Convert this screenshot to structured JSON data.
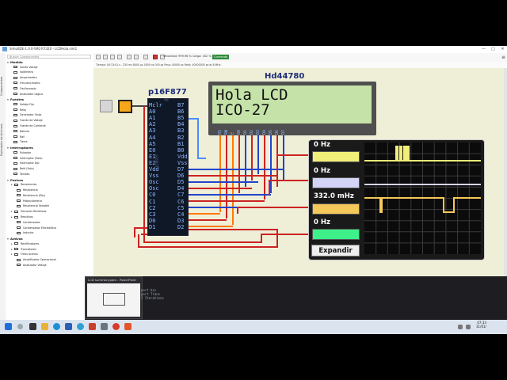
{
  "window": {
    "title": "SimulIDE-1.0.0-SR0 R7320 - LCDHola.sim1",
    "minimize": "—",
    "maximize": "□",
    "close": "✕"
  },
  "vertical_tabs": [
    "Componentes",
    "Explorador de Archivos"
  ],
  "panel": {
    "search_placeholder": "Buscar Componentes",
    "tree": [
      {
        "type": "cat",
        "label": "Medida",
        "open": true
      },
      {
        "type": "item",
        "label": "Sonda Voltaje"
      },
      {
        "type": "item",
        "label": "Voltímetro"
      },
      {
        "type": "item",
        "label": "Amperímetro"
      },
      {
        "type": "item",
        "label": "Frecuencímetro"
      },
      {
        "type": "item",
        "label": "Osciloscopio"
      },
      {
        "type": "item",
        "label": "Analizador Lógico"
      },
      {
        "type": "cat",
        "label": "Fuentes",
        "open": true
      },
      {
        "type": "item",
        "label": "Voltaje Fijo"
      },
      {
        "type": "item",
        "label": "Reloj"
      },
      {
        "type": "item",
        "label": "Generador Onda"
      },
      {
        "type": "item",
        "label": "Fuente de Voltaje"
      },
      {
        "type": "item",
        "label": "Fuente de Corriente"
      },
      {
        "type": "item",
        "label": "Batería"
      },
      {
        "type": "item",
        "label": "Raíl"
      },
      {
        "type": "item",
        "label": "Tierra"
      },
      {
        "type": "cat",
        "label": "Interruptores",
        "open": true
      },
      {
        "type": "item",
        "label": "Pulsador"
      },
      {
        "type": "item",
        "label": "Interruptor (Sola)"
      },
      {
        "type": "item",
        "label": "Interruptor Dip"
      },
      {
        "type": "item",
        "label": "Relé (Sola)"
      },
      {
        "type": "item",
        "label": "Teclado"
      },
      {
        "type": "cat",
        "label": "Pasivos",
        "open": true
      },
      {
        "type": "sub",
        "label": "Resistencias"
      },
      {
        "type": "item2",
        "label": "Resistencia"
      },
      {
        "type": "item2",
        "label": "Resistencia (Dip)"
      },
      {
        "type": "item2",
        "label": "Potenciómetro"
      },
      {
        "type": "item2",
        "label": "Resistencia Variable"
      },
      {
        "type": "sub",
        "label": "Sensores Resistivos"
      },
      {
        "type": "sub",
        "label": "Reactivos"
      },
      {
        "type": "item2",
        "label": "Condensador"
      },
      {
        "type": "item2",
        "label": "Condensador Electrolítico"
      },
      {
        "type": "item2",
        "label": "Inductor"
      },
      {
        "type": "cat",
        "label": "Activos",
        "open": true
      },
      {
        "type": "sub",
        "label": "Rectificadores"
      },
      {
        "type": "sub",
        "label": "Transistores"
      },
      {
        "type": "sub",
        "label": "Otros Activos"
      },
      {
        "type": "item2",
        "label": "Amplificador Operacional"
      },
      {
        "type": "item2",
        "label": "Analizador Voltaje"
      }
    ]
  },
  "toolbar": {
    "speed": "Velocidad: 999.96 %   Carga: 402 %",
    "state": "Corriendo"
  },
  "status": {
    "text": "Tiempo: 00:13:01.s - 230 ms  8000 μs  0000 ns  000 ps          Paso: 40000 ps  Reloj: 40000000 ps  at 8 MHz"
  },
  "circuit": {
    "pic_label": "p16F877",
    "pic_model": "p16f877",
    "lcd_label": "Hd44780",
    "lcd_line1": "Hola LCD",
    "lcd_line2": "ICO-27",
    "pins_left": [
      "Mclr",
      "A0",
      "A1",
      "A2",
      "A3",
      "A4",
      "A5",
      "E0",
      "E1",
      "E2",
      "Vdd",
      "Vss",
      "Osc",
      "Osc",
      "C0",
      "C1",
      "C2",
      "C3",
      "D0",
      "D1"
    ],
    "pins_right": [
      "B7",
      "B6",
      "B5",
      "B4",
      "B3",
      "B2",
      "B1",
      "B0",
      "Vdd",
      "Vss",
      "D7",
      "D6",
      "D5",
      "D4",
      "C7",
      "C6",
      "C5",
      "C4",
      "D3",
      "D2"
    ],
    "lcd_pins": [
      "RS",
      "RW",
      "E",
      "D0",
      "D1",
      "D2",
      "D3",
      "D4",
      "D5",
      "D6",
      "D7"
    ]
  },
  "scope": {
    "channels": [
      {
        "freq": "0 Hz",
        "color": "#f1ef7a"
      },
      {
        "freq": "0 Hz",
        "color": "#d4d4f7"
      },
      {
        "freq": "332.0 mHz",
        "color": "#f5c85a"
      },
      {
        "freq": "0 Hz",
        "color": "#3df08a"
      }
    ],
    "expand_label": "Expandir"
  },
  "popup": {
    "title": "LCD summary.pptx - PowerPoint",
    "code": "port bsc\nport Trans\n2 Iterations"
  },
  "taskbar": {
    "time": "07:33",
    "date": "31/01/"
  }
}
